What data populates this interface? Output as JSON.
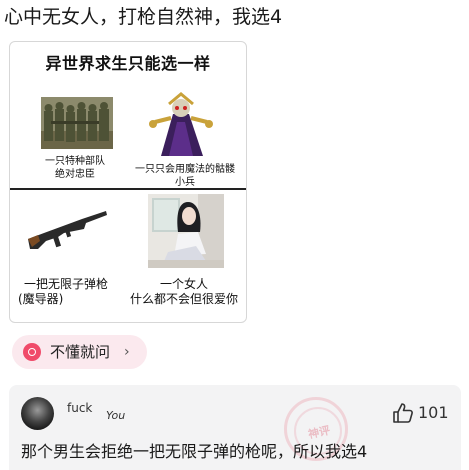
{
  "post": {
    "title": "心中无女人，打枪自然神，我选4"
  },
  "meme": {
    "heading": "异世界求生只能选一样",
    "options": [
      {
        "caption_line1": "一只特种部队",
        "caption_line2": "绝对忠臣",
        "image_icon": "soldiers-image"
      },
      {
        "caption_line1": "一只只会用魔法的骷髅",
        "caption_line2": "小兵",
        "image_icon": "skeleton-mage-image"
      },
      {
        "caption_line1": "一把无限子弹枪",
        "caption_line2": "(魔导器)",
        "image_icon": "rifle-image"
      },
      {
        "caption_line1": "一个女人",
        "caption_line2": "什么都不会但很爱你",
        "image_icon": "girl-image"
      }
    ]
  },
  "hint": {
    "label": "不懂就问",
    "chevron": "›",
    "icon": "question-icon",
    "color": "#f04b6a"
  },
  "comment": {
    "username": "fuck",
    "user_tag": "You",
    "like_count": "101",
    "text": "那个男生会拒绝一把无限子弹的枪呢，所以我选4",
    "avatar_icon": "avatar",
    "like_icon": "thumbs-up-icon"
  }
}
